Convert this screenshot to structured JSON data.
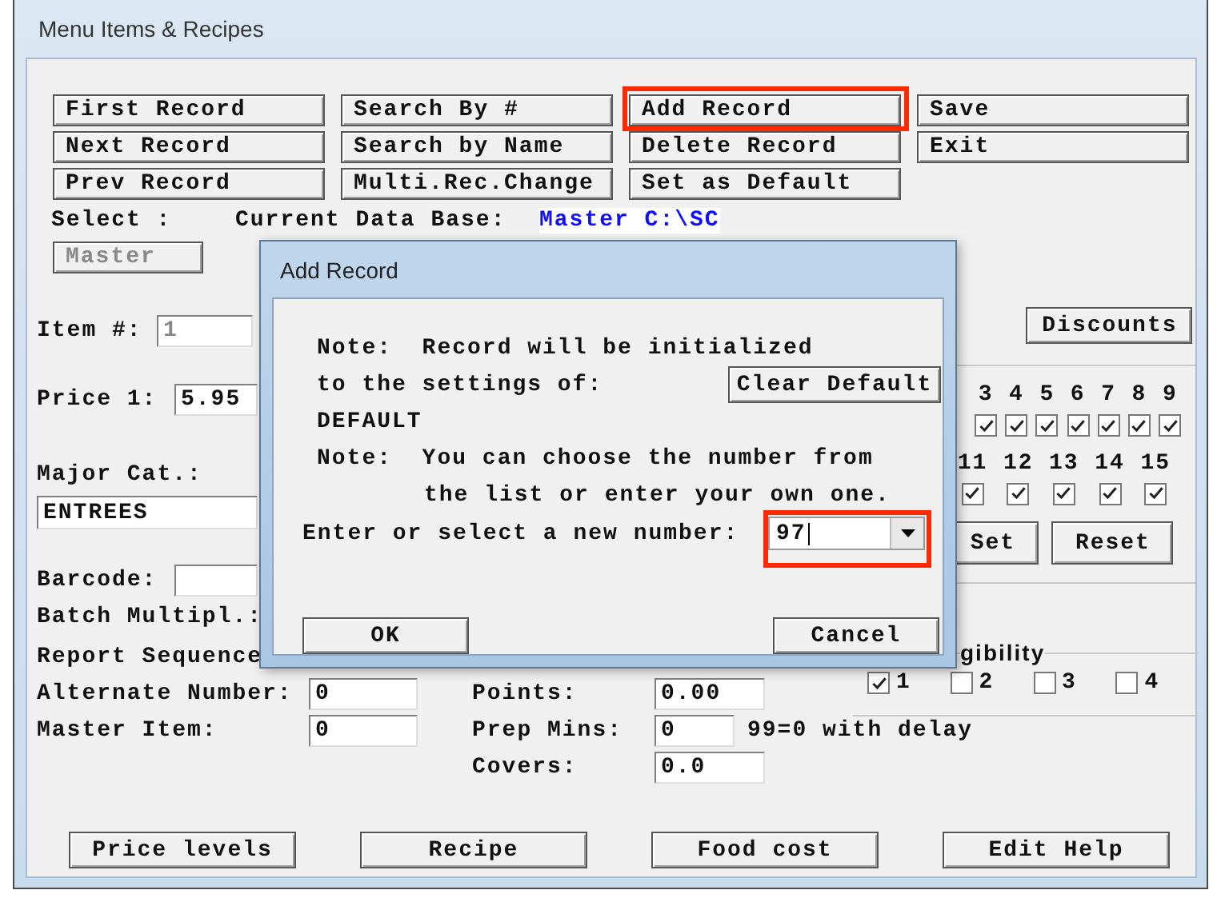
{
  "window": {
    "title": "Menu Items & Recipes"
  },
  "buttons": [
    {
      "label": "First Record",
      "highlighted": false
    },
    {
      "label": "Search By #",
      "highlighted": false
    },
    {
      "label": "Add Record",
      "highlighted": true
    },
    {
      "label": "Save",
      "highlighted": false
    },
    {
      "label": "Next Record",
      "highlighted": false
    },
    {
      "label": "Search by Name",
      "highlighted": false
    },
    {
      "label": "Delete Record",
      "highlighted": false
    },
    {
      "label": "Exit",
      "highlighted": false
    },
    {
      "label": "Prev Record",
      "highlighted": false
    },
    {
      "label": "Multi.Rec.Change",
      "highlighted": false
    },
    {
      "label": "Set as Default",
      "highlighted": false
    }
  ],
  "database": {
    "select_label": "Select :",
    "current_label": "Current Data Base:",
    "value": "Master C:\\SC"
  },
  "master_button": {
    "label": "Master",
    "disabled": true
  },
  "item_number": {
    "label": "Item #:",
    "value": "1",
    "disabled": true
  },
  "price": {
    "label": "Price 1:",
    "value": "5.95"
  },
  "major_category": {
    "label": "Major Cat.:",
    "value": "ENTREES"
  },
  "barcode": {
    "label": "Barcode:"
  },
  "batch_multiplier": {
    "label": "Batch Multipl.:"
  },
  "report_sequence": {
    "label": "Report Sequence"
  },
  "alternate_number": {
    "label": "Alternate Number:",
    "value": "0"
  },
  "master_item": {
    "label": "Master Item:",
    "value": "0"
  },
  "points": {
    "label": "Points:",
    "value": "0.00"
  },
  "prep_mins": {
    "label": "Prep Mins:",
    "value": "0",
    "note": "99=0 with delay"
  },
  "covers": {
    "label": "Covers:",
    "value": "0.0"
  },
  "discounts_button": "Discounts",
  "levels_row_1": [
    {
      "label": "3",
      "checked": true
    },
    {
      "label": "4",
      "checked": true
    },
    {
      "label": "5",
      "checked": true
    },
    {
      "label": "6",
      "checked": true
    },
    {
      "label": "7",
      "checked": true
    },
    {
      "label": "8",
      "checked": true
    },
    {
      "label": "9",
      "checked": true
    }
  ],
  "levels_row_2": [
    {
      "label": "11",
      "checked": true
    },
    {
      "label": "12",
      "checked": true
    },
    {
      "label": "13",
      "checked": true
    },
    {
      "label": "14",
      "checked": true
    },
    {
      "label": "15",
      "checked": true
    }
  ],
  "set_button": "Set",
  "reset_button": "Reset",
  "eligibility": {
    "title": "gibility",
    "options": [
      {
        "label": "1",
        "checked": true
      },
      {
        "label": "2",
        "checked": false
      },
      {
        "label": "3",
        "checked": false
      },
      {
        "label": "4",
        "checked": false
      }
    ]
  },
  "bottom_buttons": [
    "Price levels",
    "Recipe",
    "Food cost",
    "Edit Help"
  ],
  "dialog": {
    "title": "Add Record",
    "lines": [
      {
        "text": "Note:  Record will be initialized",
        "indented": false
      },
      {
        "text": "to the settings of:",
        "indented": false
      },
      {
        "text": "DEFAULT",
        "indented": false
      },
      {
        "text": "Note:  You can choose the number from",
        "indented": false
      },
      {
        "text": "the list or enter your own one.",
        "indented": true
      }
    ],
    "clear_default_button": "Clear Default",
    "prompt": "Enter or select a new number:",
    "number": {
      "value": "97",
      "highlighted": true
    },
    "ok_button": "OK",
    "cancel_button": "Cancel"
  }
}
